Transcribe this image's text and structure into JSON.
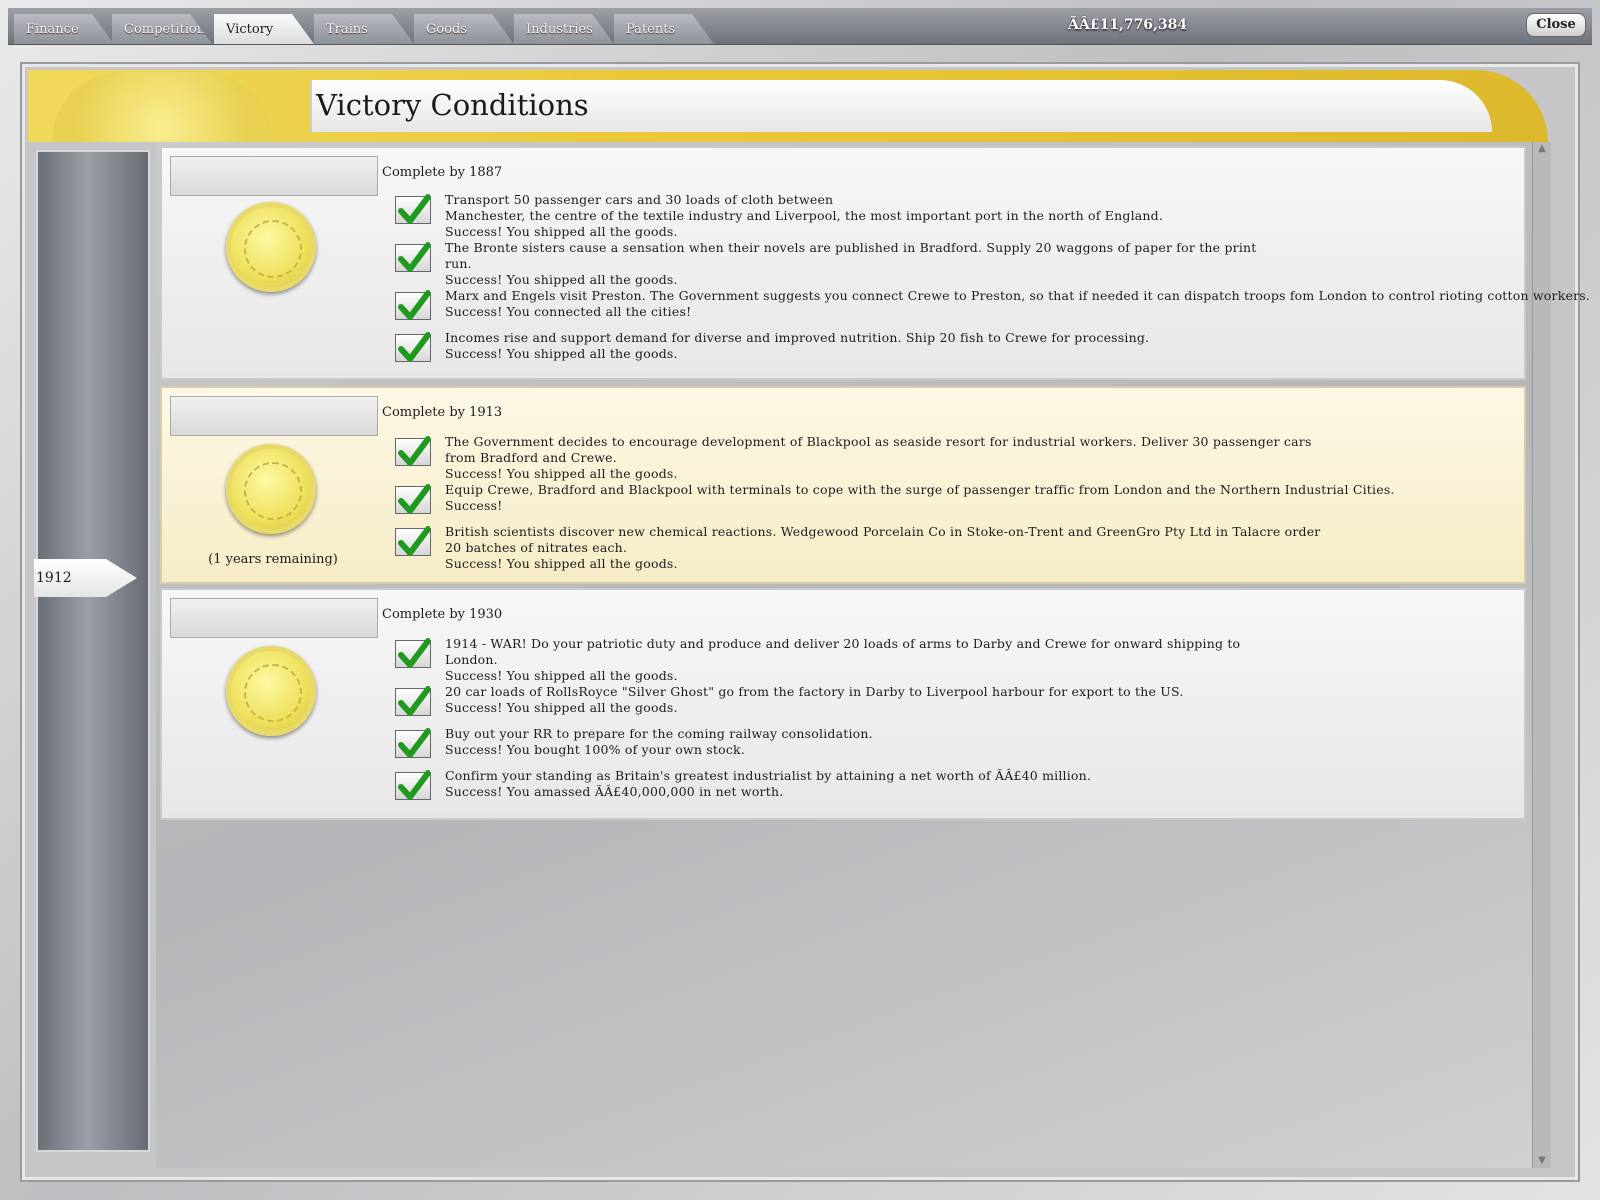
{
  "tabs": [
    {
      "label": "Finance"
    },
    {
      "label": "Competition"
    },
    {
      "label": "Victory"
    },
    {
      "label": "Trains"
    },
    {
      "label": "Goods"
    },
    {
      "label": "Industries"
    },
    {
      "label": "Patents"
    }
  ],
  "active_tab": "Victory",
  "money": "ÃÂ£11,776,384",
  "close_label": "Close",
  "title": "Victory Conditions",
  "timeline": {
    "current_year": "1912"
  },
  "icons": {
    "medal": "gold-medal-icon",
    "check": "green-checkmark-icon"
  },
  "colors": {
    "accent_gold": "#e9c93a",
    "check_green": "#1f9a1f",
    "current_section": "#f6ecc6"
  },
  "sections": [
    {
      "deadline": "Complete by 1887",
      "remaining": "",
      "objectives": [
        {
          "done": true,
          "lines": [
            "Transport 50 passenger cars and 30 loads of cloth between",
            "Manchester, the centre of the textile industry and Liverpool, the most important port in the north of England.",
            "Success! You shipped all the goods."
          ]
        },
        {
          "done": true,
          "lines": [
            "The Bronte sisters cause a sensation when their novels are published in Bradford. Supply 20 waggons of paper for the print",
            "run.",
            "Success! You shipped all the goods."
          ]
        },
        {
          "done": true,
          "lines": [
            "Marx and Engels visit Preston. The Government suggests you connect Crewe to Preston, so that if needed it can dispatch troops fom London to control rioting cotton workers.",
            "Success! You connected all the cities!"
          ]
        },
        {
          "done": true,
          "lines": [
            "Incomes rise and support demand for diverse and improved nutrition. Ship 20 fish to Crewe for processing.",
            "Success! You shipped all the goods."
          ]
        }
      ]
    },
    {
      "deadline": "Complete by 1913",
      "remaining": "(1 years remaining)",
      "objectives": [
        {
          "done": true,
          "lines": [
            "The Government decides to encourage development of Blackpool as seaside resort for industrial workers. Deliver 30 passenger cars",
            "from Bradford and Crewe.",
            "Success! You shipped all the goods."
          ]
        },
        {
          "done": true,
          "lines": [
            "Equip Crewe, Bradford and Blackpool with terminals to cope with the surge of passenger traffic from London and the Northern Industrial Cities.",
            "Success!"
          ]
        },
        {
          "done": true,
          "lines": [
            "British scientists discover new chemical reactions. Wedgewood Porcelain Co in Stoke-on-Trent and GreenGro Pty Ltd in Talacre order",
            "20 batches of nitrates each.",
            "Success! You shipped all the goods."
          ]
        }
      ]
    },
    {
      "deadline": "Complete by 1930",
      "remaining": "",
      "objectives": [
        {
          "done": true,
          "lines": [
            "1914 - WAR! Do your patriotic duty and produce and deliver 20 loads of arms to Darby and Crewe for onward shipping to",
            "London.",
            "Success! You shipped all the goods."
          ]
        },
        {
          "done": true,
          "lines": [
            "20 car loads of RollsRoyce \"Silver Ghost\" go from the factory in Darby to Liverpool harbour for export to the US.",
            "Success! You shipped all the goods."
          ]
        },
        {
          "done": true,
          "lines": [
            "Buy out your RR to prepare for the coming railway consolidation.",
            "Success! You bought 100% of your own stock."
          ]
        },
        {
          "done": true,
          "lines": [
            "Confirm your standing as Britain's greatest industrialist by attaining a net worth of ÃÂ£40 million.",
            "Success! You amassed ÃÂ£40,000,000 in net worth."
          ]
        }
      ]
    }
  ]
}
